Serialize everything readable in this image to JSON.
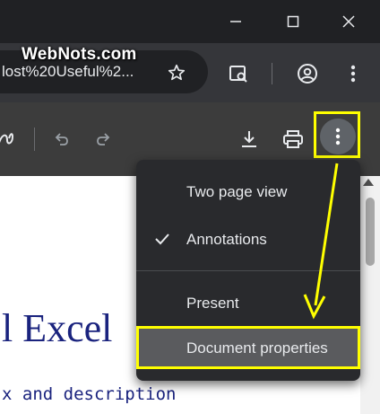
{
  "window": {
    "minimize_icon": "minimize-icon",
    "maximize_icon": "maximize-icon",
    "close_icon": "close-icon"
  },
  "watermark": "WebNots.com",
  "addressbar": {
    "url": "lost%20Useful%2..."
  },
  "document": {
    "heading": "l Excel",
    "subheading": "x and description"
  },
  "menu": {
    "items": [
      {
        "label": "Two page view",
        "checked": false
      },
      {
        "label": "Annotations",
        "checked": true
      },
      {
        "label": "Present",
        "checked": false
      },
      {
        "label": "Document properties",
        "checked": false,
        "highlighted": true
      }
    ]
  },
  "colors": {
    "highlight": "#ffff00",
    "document_text": "#1a237e"
  }
}
